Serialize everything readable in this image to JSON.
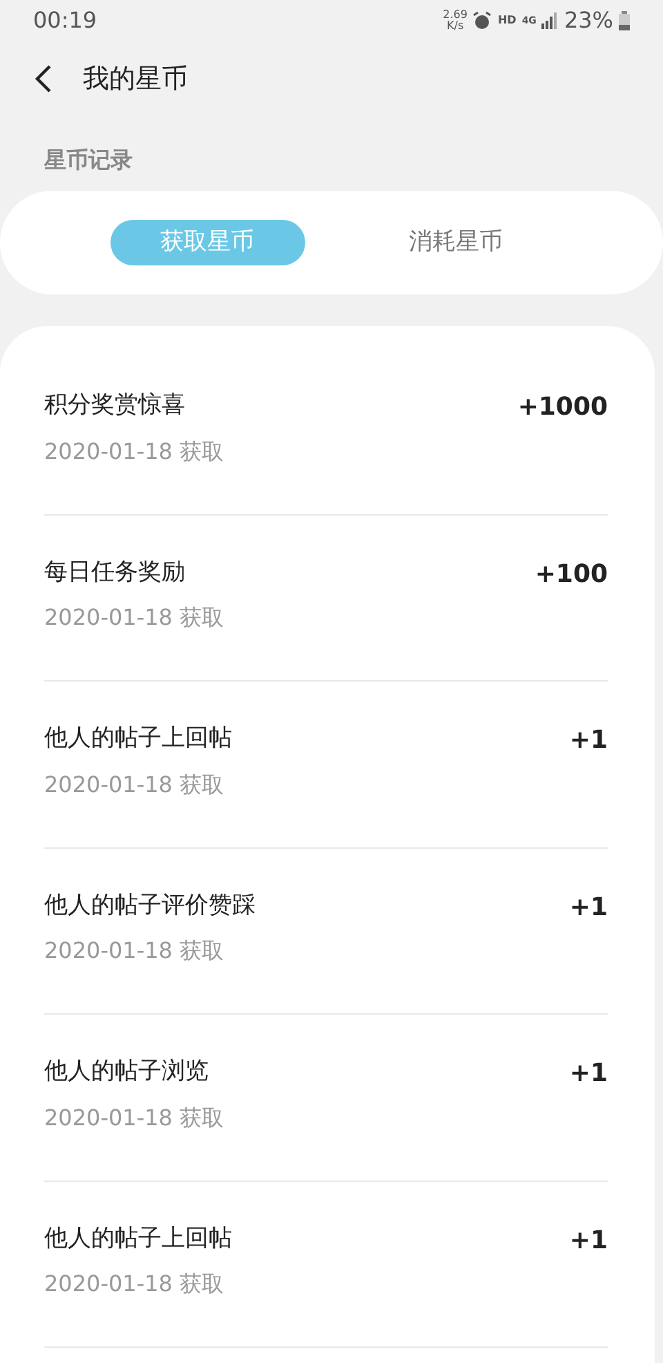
{
  "status_bar": {
    "time": "00:19",
    "speed_value": "2.69",
    "speed_unit": "K/s",
    "hd": "HD",
    "network": "4G",
    "battery": "23%"
  },
  "header": {
    "title": "我的星币"
  },
  "section_title": "星币记录",
  "tabs": [
    {
      "label": "获取星币",
      "selected": true
    },
    {
      "label": "消耗星币",
      "selected": false
    }
  ],
  "records": [
    {
      "title": "积分奖赏惊喜",
      "date": "2020-01-18 获取",
      "amount": "+1000"
    },
    {
      "title": "每日任务奖励",
      "date": "2020-01-18 获取",
      "amount": "+100"
    },
    {
      "title": "他人的帖子上回帖",
      "date": "2020-01-18 获取",
      "amount": "+1"
    },
    {
      "title": "他人的帖子评价赞踩",
      "date": "2020-01-18 获取",
      "amount": "+1"
    },
    {
      "title": "他人的帖子浏览",
      "date": "2020-01-18 获取",
      "amount": "+1"
    },
    {
      "title": "他人的帖子上回帖",
      "date": "2020-01-18 获取",
      "amount": "+1"
    }
  ]
}
